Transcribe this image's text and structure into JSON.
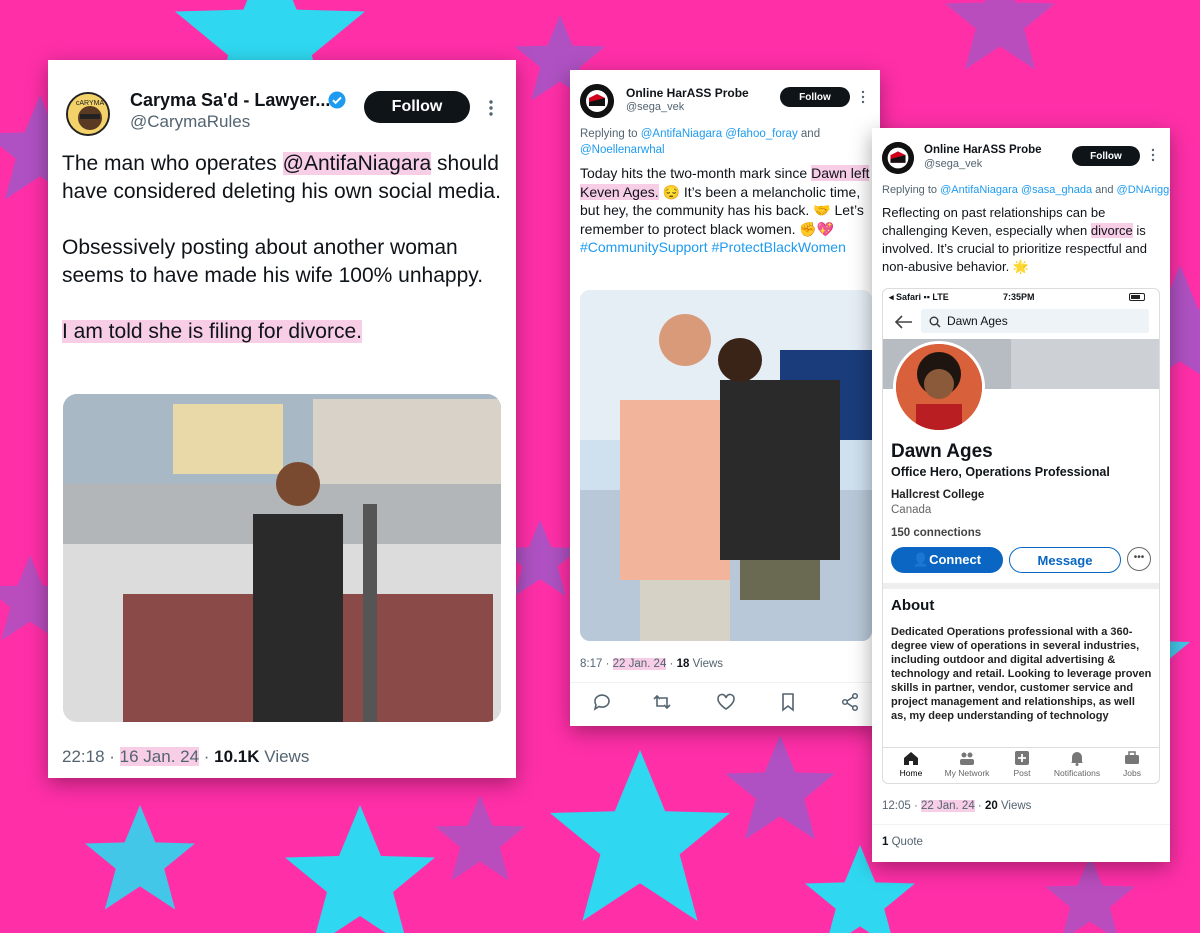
{
  "colors": {
    "background": "#ff2fa8",
    "star_cyan": "#2fd8f0",
    "star_purple": "#9b5ac8",
    "highlight": "#f8cde6",
    "link": "#1d9bf0",
    "linkedin_blue": "#0a66c2"
  },
  "tweet1": {
    "name": "Caryma Sa'd - Lawyer...",
    "handle": "@CarymaRules",
    "follow_label": "Follow",
    "icons": [
      "verified-badge-icon",
      "more-icon"
    ],
    "body": {
      "p1_a": "The man who operates ",
      "p1_mention": "@AntifaNiagara",
      "p1_b": " should have considered deleting his own social media.",
      "p2": "Obsessively posting about another woman seems to have made his wife 100% unhappy.",
      "p3": "I am told she is filing for divorce."
    },
    "time": "22:18",
    "date": "16 Jan. 24",
    "views_count": "10.1K",
    "views_label": "Views"
  },
  "tweet2": {
    "name": "Online HarASS Probe",
    "handle": "@sega_vek",
    "follow_label": "Follow",
    "replying_prefix": "Replying to ",
    "replying_to": "@AntifaNiagara @fahoo_foray",
    "replying_and": " and",
    "replying_last": "@Noellenarwhal",
    "body": {
      "a": "Today hits the two-month mark since ",
      "highlight": "Dawn left Keven Ages.",
      "b": " 😔 It’s been a melancholic time, but hey, the community has his back. 🤝 Let’s remember to protect black women. ✊💖 ",
      "hashtags": "#CommunitySupport #ProtectBlackWomen"
    },
    "time": "8:17",
    "date": "22 Jan. 24",
    "views_count": "18",
    "views_label": "Views",
    "actions": [
      "reply-icon",
      "retweet-icon",
      "like-icon",
      "bookmark-icon",
      "share-icon"
    ]
  },
  "tweet3": {
    "name": "Online HarASS Probe",
    "handle": "@sega_vek",
    "follow_label": "Follow",
    "replying_prefix": "Replying to ",
    "replying_to": "@AntifaNiagara @sasa_ghada",
    "replying_and": " and ",
    "replying_last": "@DNArigge",
    "body": {
      "a": "Reflecting on past relationships can be challenging Keven, especially when ",
      "highlight": "divorce",
      "b": " is involved. It’s crucial to prioritize respectful and non-abusive behavior. 🌟"
    },
    "phone": {
      "carrier": "◂ Safari ▪▪ LTE",
      "clock": "7:35PM",
      "search_value": "Dawn Ages",
      "profile_name": "Dawn Ages",
      "headline": "Office Hero, Operations Professional",
      "org": "Hallcrest College",
      "location": "Canada",
      "connections": "150 connections",
      "connect_label": "Connect",
      "message_label": "Message",
      "more_label": "•••",
      "about_heading": "About",
      "about_text": "Dedicated Operations professional with a 360-degree view of operations in several industries, including outdoor and digital advertising & technology and retail. Looking to leverage proven skills in partner, vendor, customer service and project management and relationships, as well as, my deep understanding of technology",
      "nav": [
        "Home",
        "My Network",
        "Post",
        "Notifications",
        "Jobs"
      ]
    },
    "time": "12:05",
    "date": "22 Jan. 24",
    "views_count": "20",
    "views_label": "Views",
    "quote_count": "1",
    "quote_label": "Quote"
  }
}
